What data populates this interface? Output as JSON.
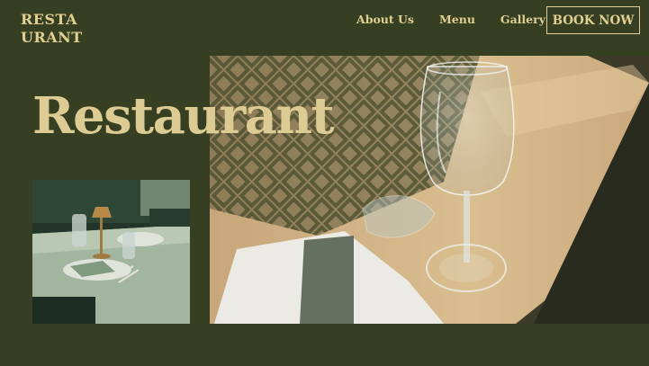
{
  "brand": {
    "line1": "RESTA",
    "line2": "URANT"
  },
  "nav": {
    "items": [
      "About Us",
      "Menu",
      "Gallery"
    ],
    "cta": "BOOK NOW"
  },
  "hero": {
    "title": "Restaurant"
  },
  "colors": {
    "background": "#363f22",
    "accent": "#e0cf92"
  }
}
